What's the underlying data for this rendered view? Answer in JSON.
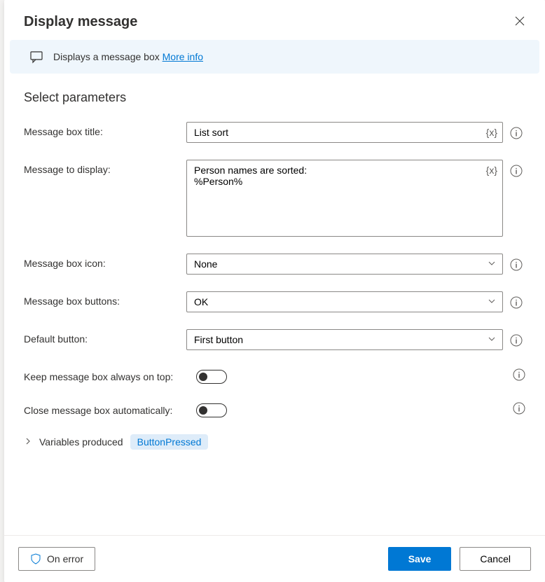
{
  "header": {
    "title": "Display message"
  },
  "banner": {
    "text": "Displays a message box",
    "link": "More info"
  },
  "section_title": "Select parameters",
  "var_token": "{x}",
  "fields": {
    "title": {
      "label": "Message box title:",
      "value": "List sort"
    },
    "message": {
      "label": "Message to display:",
      "value": "Person names are sorted:\n%Person%"
    },
    "icon": {
      "label": "Message box icon:",
      "value": "None"
    },
    "buttons": {
      "label": "Message box buttons:",
      "value": "OK"
    },
    "default_button": {
      "label": "Default button:",
      "value": "First button"
    },
    "always_on_top": {
      "label": "Keep message box always on top:"
    },
    "auto_close": {
      "label": "Close message box automatically:"
    }
  },
  "variables": {
    "label": "Variables produced",
    "badge": "ButtonPressed"
  },
  "footer": {
    "on_error": "On error",
    "save": "Save",
    "cancel": "Cancel"
  }
}
